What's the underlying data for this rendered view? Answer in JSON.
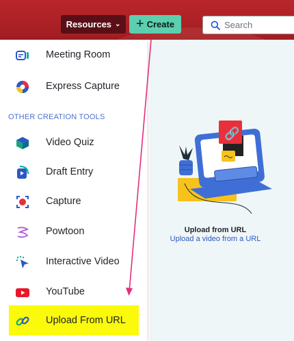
{
  "topbar": {
    "resources_label": "Resources",
    "create_label": "Create",
    "search_placeholder": "Search"
  },
  "menu": {
    "items_top": [
      {
        "label": "Meeting Room",
        "icon": "meeting-room-icon"
      },
      {
        "label": "Express Capture",
        "icon": "express-capture-icon"
      }
    ],
    "section_label": "OTHER CREATION TOOLS",
    "items": [
      {
        "label": "Video Quiz",
        "icon": "video-quiz-icon"
      },
      {
        "label": "Draft Entry",
        "icon": "draft-entry-icon"
      },
      {
        "label": "Capture",
        "icon": "capture-icon"
      },
      {
        "label": "Powtoon",
        "icon": "powtoon-icon"
      },
      {
        "label": "Interactive Video",
        "icon": "interactive-video-icon"
      },
      {
        "label": "YouTube",
        "icon": "youtube-icon"
      },
      {
        "label": "Upload From URL",
        "icon": "link-icon",
        "highlighted": true
      }
    ]
  },
  "content": {
    "upload_title": "Upload from URL",
    "upload_subtitle": "Upload a video from a URL"
  },
  "colors": {
    "topbar": "#a11d22",
    "resources_button": "#5a0f17",
    "create_button": "#5ccfb0",
    "highlight": "#fafa0a",
    "arrow": "#e0307a",
    "accent_blue": "#2c58c6"
  }
}
